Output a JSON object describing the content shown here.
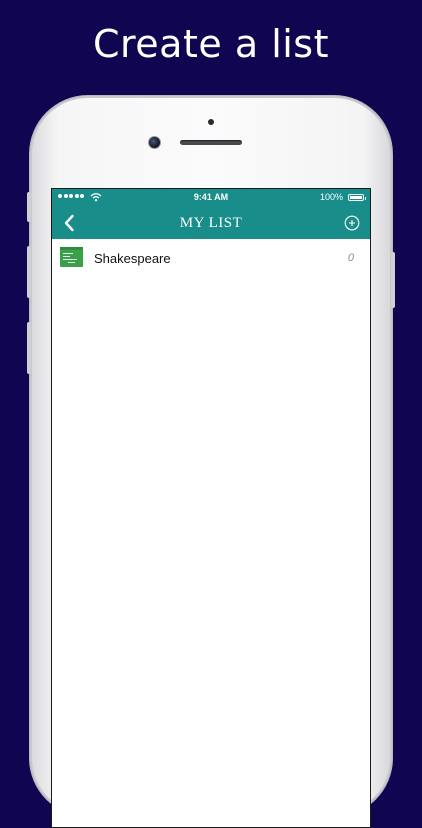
{
  "headline": "Create a list",
  "status_bar": {
    "time": "9:41 AM",
    "battery_percent": "100%"
  },
  "nav": {
    "title": "MY LIST",
    "back_icon": "chevron-left-icon",
    "add_icon": "plus-circle-icon"
  },
  "lists": [
    {
      "name": "Shakespeare",
      "count": "0",
      "icon": "list-document-icon"
    }
  ],
  "colors": {
    "background": "#0f0550",
    "accent": "#198d8a",
    "list_icon": "#3aa14a"
  }
}
